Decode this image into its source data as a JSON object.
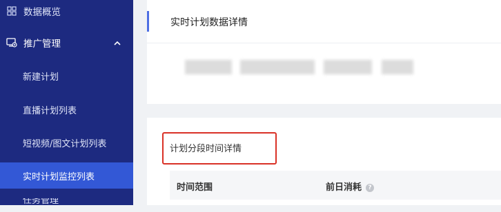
{
  "sidebar": {
    "items": [
      {
        "label": "数据概览",
        "icon": "grid-icon"
      },
      {
        "label": "推广管理",
        "icon": "promotion-icon"
      },
      {
        "label": "新建计划"
      },
      {
        "label": "直播计划列表"
      },
      {
        "label": "短视频/图文计划列表"
      },
      {
        "label": "实时计划监控列表"
      }
    ],
    "partial_label": "任务管理"
  },
  "main": {
    "card_title": "实时计划数据详情",
    "section_title": "计划分段时间详情",
    "table_headers": [
      "时间范围",
      "前日消耗"
    ],
    "help_glyph": "?"
  },
  "colors": {
    "sidebar_bg": "#1d2a80",
    "active_bg": "#3358d6",
    "accent": "#4d6ee3",
    "highlight": "#d93025"
  }
}
